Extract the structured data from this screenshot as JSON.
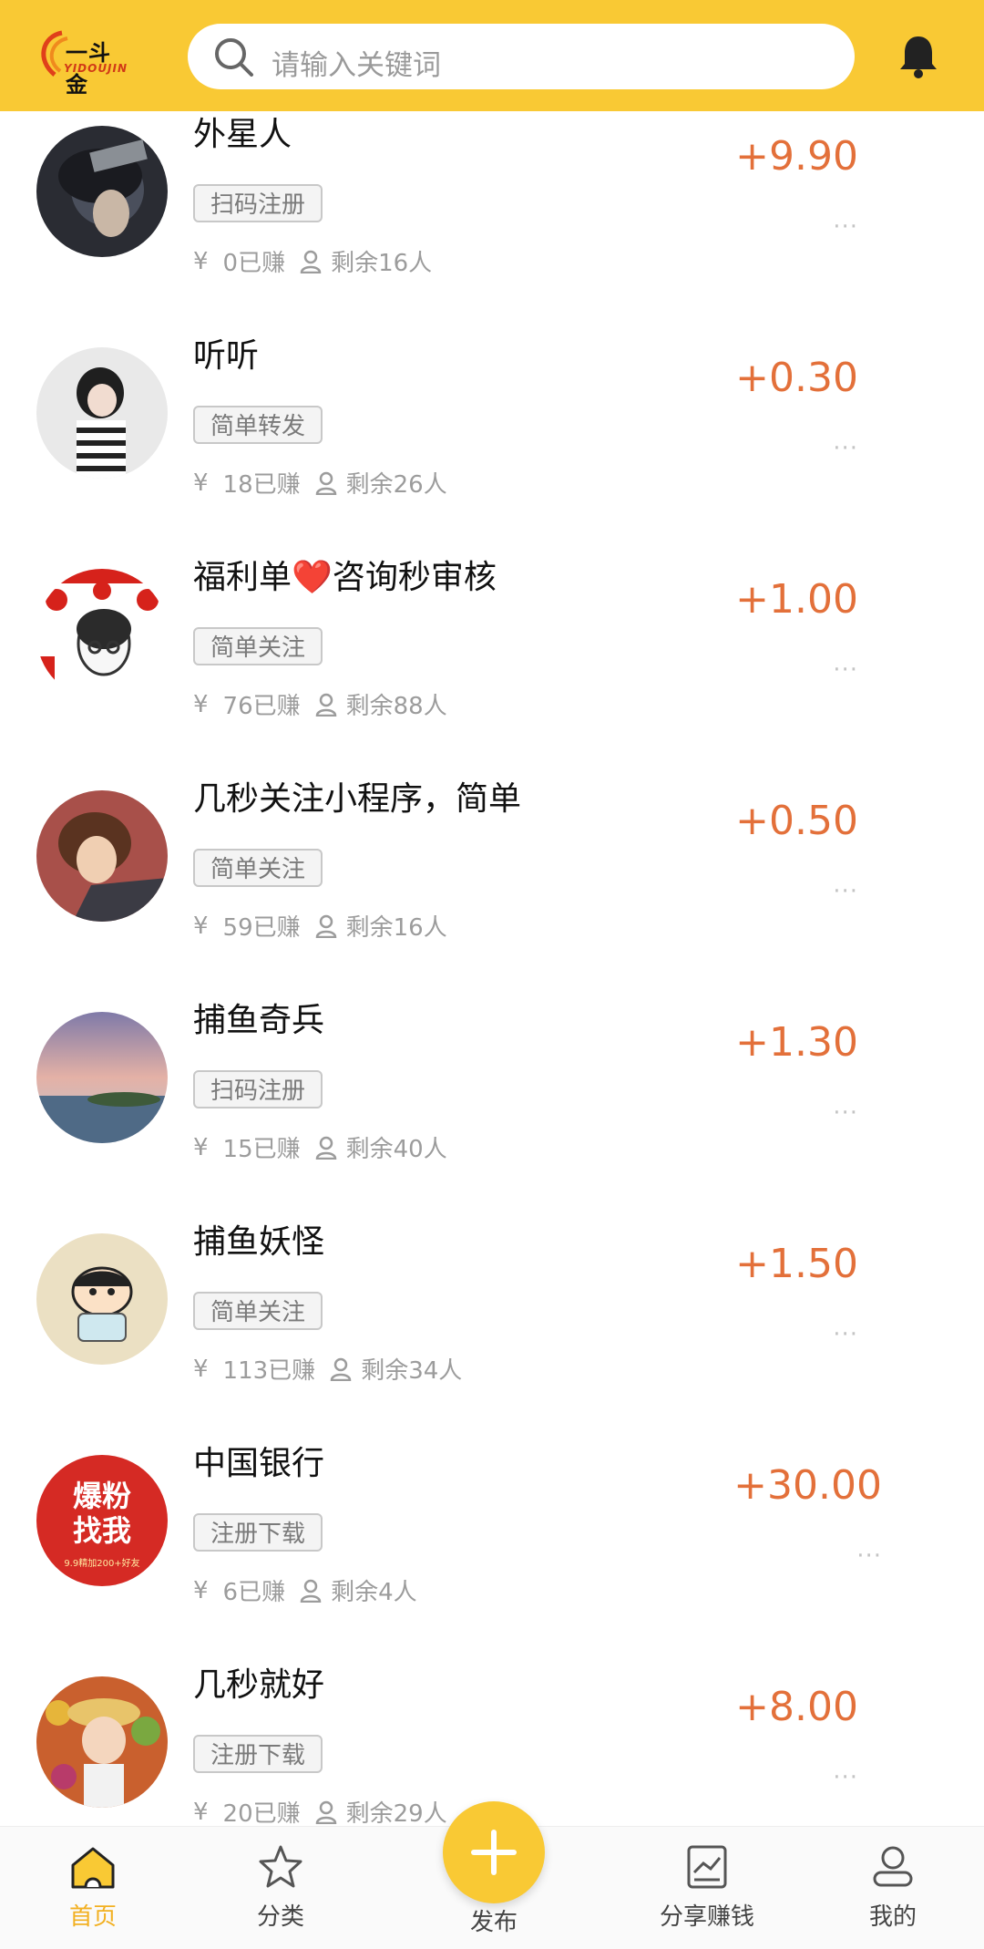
{
  "header": {
    "logo_text": "一斗金",
    "logo_sub": "YIDOUJIN",
    "search_placeholder": "请输入关键词"
  },
  "tasks": [
    {
      "title": "外星人",
      "tag": "扫码注册",
      "earned": "0已赚",
      "remaining": "剩余16人",
      "price": "+9.90",
      "more": "···"
    },
    {
      "title": "听听",
      "tag": "简单转发",
      "earned": "18已赚",
      "remaining": "剩余26人",
      "price": "+0.30",
      "more": "···"
    },
    {
      "title": "福利单❤️咨询秒审核",
      "tag": "简单关注",
      "earned": "76已赚",
      "remaining": "剩余88人",
      "price": "+1.00",
      "more": "···"
    },
    {
      "title": "几秒关注小程序，简单",
      "tag": "简单关注",
      "earned": "59已赚",
      "remaining": "剩余16人",
      "price": "+0.50",
      "more": "···"
    },
    {
      "title": "捕鱼奇兵",
      "tag": "扫码注册",
      "earned": "15已赚",
      "remaining": "剩余40人",
      "price": "+1.30",
      "more": "···"
    },
    {
      "title": "捕鱼妖怪",
      "tag": "简单关注",
      "earned": "113已赚",
      "remaining": "剩余34人",
      "price": "+1.50",
      "more": "···"
    },
    {
      "title": "中国银行",
      "tag": "注册下载",
      "earned": "6已赚",
      "remaining": "剩余4人",
      "price": "+30.00",
      "more": "···",
      "avatar_line1": "爆粉",
      "avatar_line2": "找我",
      "avatar_line3": "9.9精加200+好友"
    },
    {
      "title": "几秒就好",
      "tag": "注册下载",
      "earned": "20已赚",
      "remaining": "剩余29人",
      "price": "+8.00",
      "more": "···"
    }
  ],
  "currency_symbol": "¥",
  "tabbar": {
    "home": "首页",
    "category": "分类",
    "publish": "发布",
    "share": "分享赚钱",
    "mine": "我的",
    "active": "home"
  },
  "colors": {
    "brand_yellow": "#f9c934",
    "price_orange": "#e3703a"
  }
}
